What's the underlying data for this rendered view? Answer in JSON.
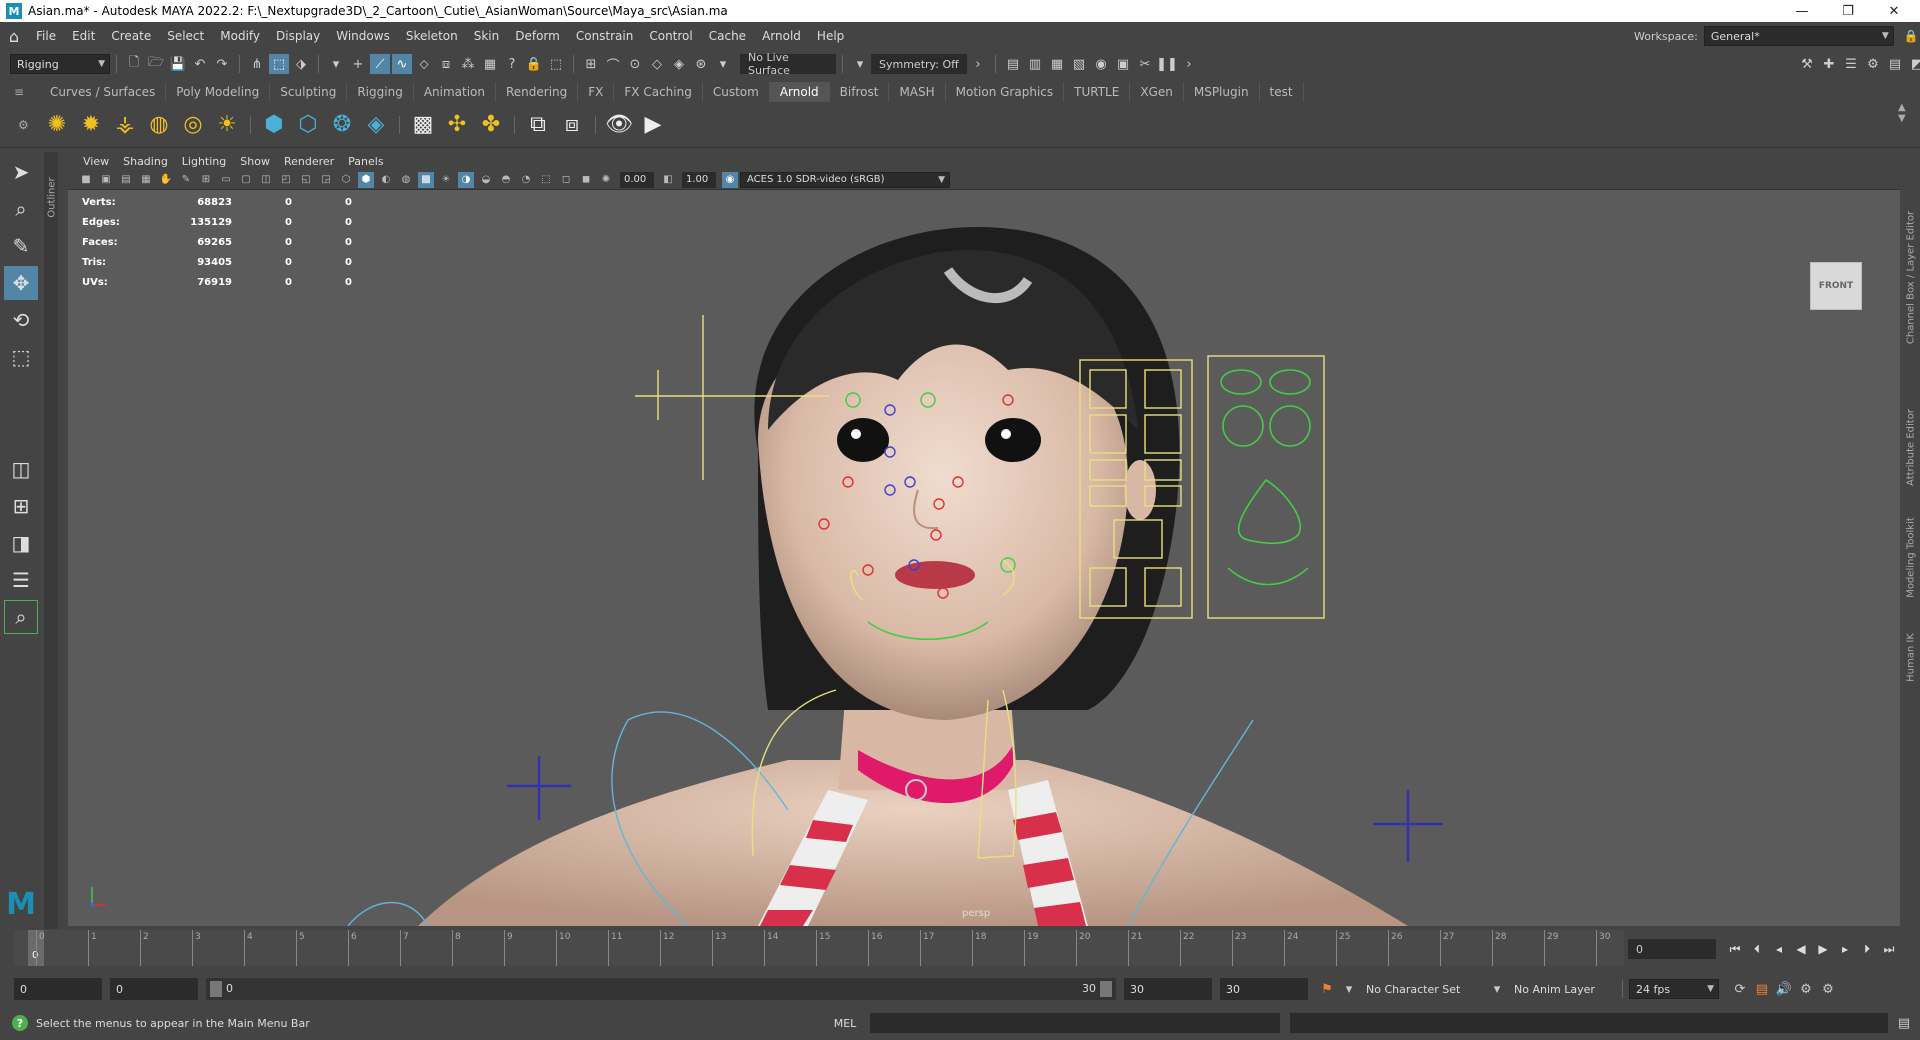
{
  "window": {
    "title": "Asian.ma* - Autodesk MAYA 2022.2: F:\\_Nextupgrade3D\\_2_Cartoon\\_Cutie\\_AsianWoman\\Source\\Maya_src\\Asian.ma",
    "app_icon": "M",
    "controls": {
      "minimize": "—",
      "maximize": "❐",
      "close": "✕"
    }
  },
  "menu": [
    "File",
    "Edit",
    "Create",
    "Select",
    "Modify",
    "Display",
    "Windows",
    "Skeleton",
    "Skin",
    "Deform",
    "Constrain",
    "Control",
    "Cache",
    "Arnold",
    "Help"
  ],
  "workspace": {
    "label": "Workspace:",
    "value": "General*"
  },
  "status_line": {
    "menuset": "Rigging",
    "live_surface": "No Live Surface",
    "symmetry": "Symmetry: Off"
  },
  "shelf": {
    "tabs": [
      "Curves / Surfaces",
      "Poly Modeling",
      "Sculpting",
      "Rigging",
      "Animation",
      "Rendering",
      "FX",
      "FX Caching",
      "Custom",
      "Arnold",
      "Bifrost",
      "MASH",
      "Motion Graphics",
      "TURTLE",
      "XGen",
      "MSPlugin",
      "test"
    ],
    "active_tab": "Arnold"
  },
  "outliner": {
    "label": "Outliner"
  },
  "panel": {
    "menus": [
      "View",
      "Shading",
      "Lighting",
      "Show",
      "Renderer",
      "Panels"
    ],
    "exposure": "0.00",
    "gamma": "1.00",
    "color_space": "ACES 1.0 SDR-video (sRGB)"
  },
  "hud": [
    {
      "label": "Verts:",
      "value": "68823",
      "sel": "0",
      "other": "0"
    },
    {
      "label": "Edges:",
      "value": "135129",
      "sel": "0",
      "other": "0"
    },
    {
      "label": "Faces:",
      "value": "69265",
      "sel": "0",
      "other": "0"
    },
    {
      "label": "Tris:",
      "value": "93405",
      "sel": "0",
      "other": "0"
    },
    {
      "label": "UVs:",
      "value": "76919",
      "sel": "0",
      "other": "0"
    }
  ],
  "viewport": {
    "camera": "persp",
    "viewcube": "FRONT"
  },
  "right_tabs": [
    "Channel Box / Layer Editor",
    "Attribute Editor",
    "Modeling Toolkit",
    "Human IK"
  ],
  "timeline": {
    "ticks": [
      "0",
      "1",
      "2",
      "3",
      "4",
      "5",
      "6",
      "7",
      "8",
      "9",
      "10",
      "11",
      "12",
      "13",
      "14",
      "15",
      "16",
      "17",
      "18",
      "19",
      "20",
      "21",
      "22",
      "23",
      "24",
      "25",
      "26",
      "27",
      "28",
      "29",
      "30"
    ],
    "current_frame": "0",
    "current_frame_field": "0"
  },
  "range": {
    "start": "0",
    "anim_start": "0",
    "slider_start": "0",
    "slider_end": "30",
    "anim_end": "30",
    "end": "30",
    "character_set": "No Character Set",
    "anim_layer": "No Anim Layer",
    "fps": "24 fps"
  },
  "command_line": {
    "help": "Select the menus to appear in the Main Menu Bar",
    "language": "MEL"
  }
}
